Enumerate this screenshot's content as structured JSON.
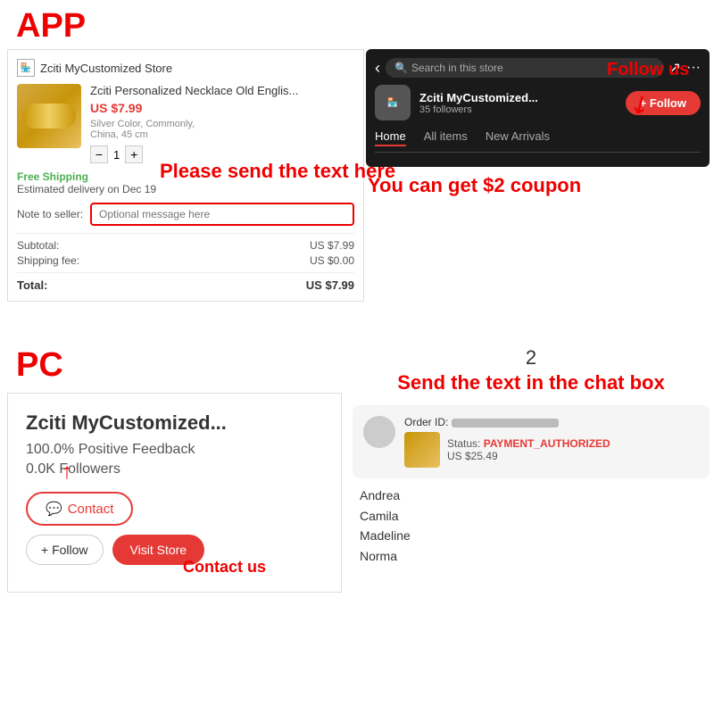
{
  "app_label": "APP",
  "pc_label": "PC",
  "store": {
    "name": "Zciti MyCustomized Store",
    "name_short": "Zciti MyCustomized...",
    "followers": "35 followers",
    "feedback": "100.0% Positive Feedback",
    "followers_count": "0.0K Followers"
  },
  "product": {
    "title": "Zciti Personalized Necklace Old Englis...",
    "price": "US $7.99",
    "attrs": "Silver Color, Commonly,\nChina, 45 cm",
    "qty": "1"
  },
  "shipping": {
    "free": "Free Shipping",
    "delivery": "Estimated delivery on Dec 19"
  },
  "note": {
    "label": "Note to seller:",
    "placeholder": "Optional message here"
  },
  "annotation": {
    "please_send": "Please send the text here",
    "follow_us": "Follow us",
    "coupon": "You can get $2 coupon",
    "send_chat_num": "2",
    "send_chat": "Send the text in the chat box",
    "contact_us": "Contact us"
  },
  "costs": {
    "subtotal_label": "Subtotal:",
    "subtotal_val": "US $7.99",
    "shipping_label": "Shipping fee:",
    "shipping_val": "US $0.00",
    "total_label": "Total:",
    "total_val": "US $7.99"
  },
  "nav": {
    "search_placeholder": "Search in this store",
    "home": "Home",
    "all_items": "All items",
    "new_arrivals": "New Arrivals"
  },
  "follow_btn": "+ Follow",
  "pc_buttons": {
    "contact": "Contact",
    "follow": "+ Follow",
    "visit": "Visit Store"
  },
  "chat": {
    "order_id_label": "Order ID:",
    "status_label": "Status:",
    "status_value": "PAYMENT_AUTHORIZED",
    "price": "US $25.49",
    "names": [
      "Andrea",
      "Camila",
      "Madeline",
      "Norma"
    ]
  }
}
